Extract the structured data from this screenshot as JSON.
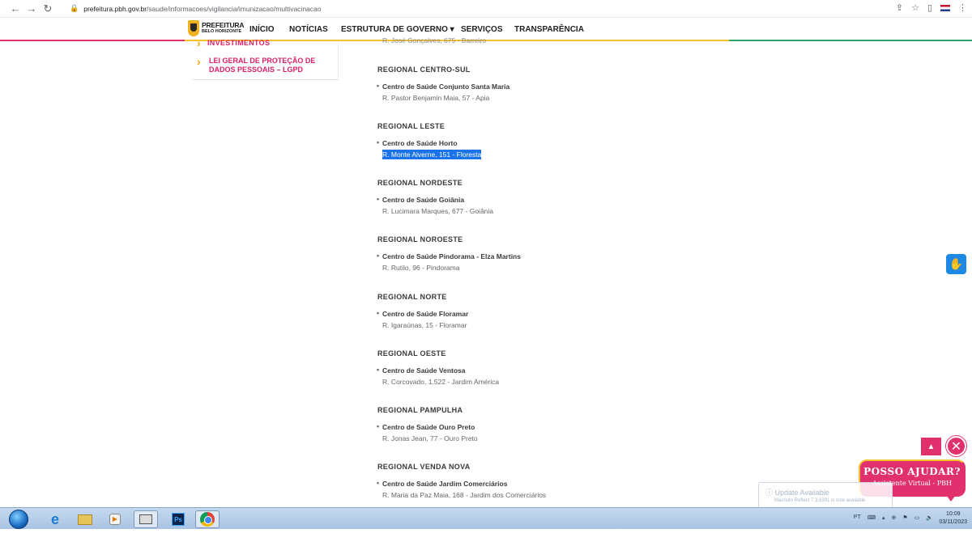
{
  "browser": {
    "url_domain": "prefeitura.pbh.gov.br",
    "url_path": "/saude/informacoes/vigilancia/imunizacao/multivacinacao"
  },
  "header": {
    "logo_line1": "PREFEITURA",
    "logo_line2": "BELO HORIZONTE",
    "menu": [
      {
        "label": "INÍCIO"
      },
      {
        "label": "NOTÍCIAS"
      },
      {
        "label": "ESTRUTURA DE GOVERNO ▾"
      },
      {
        "label": "SERVIÇOS"
      },
      {
        "label": "TRANSPARÊNCIA"
      }
    ]
  },
  "sidebar": {
    "cut_item": "INVESTIMENTOS",
    "item": "LEI GERAL DE PROTEÇÃO DE DADOS PESSOAIS – LGPD"
  },
  "main": {
    "cut_text": "R. José Gonçalves, 675 - Barreiro",
    "regions": [
      {
        "title": "REGIONAL CENTRO-SUL",
        "center": "Centro de Saúde Conjunto Santa Maria",
        "address": "R. Pastor Benjamin Maia, 57 - Apia"
      },
      {
        "title": "REGIONAL LESTE",
        "center": "Centro de Saúde Horto",
        "address": "R. Monte Alverne, 151 - Floresta"
      },
      {
        "title": "REGIONAL NORDESTE",
        "center": "Centro de Saúde Goiânia",
        "address": "R. Lucimara Marques, 677 - Goiânia"
      },
      {
        "title": "REGIONAL NOROESTE",
        "center": "Centro de Saúde Pindorama - Elza Martins",
        "address": "R. Rutilo, 96 - Pindorama"
      },
      {
        "title": "REGIONAL NORTE",
        "center": "Centro de Saúde Floramar",
        "address": "R. Igaraúnas, 15 - Floramar"
      },
      {
        "title": "REGIONAL OESTE",
        "center": "Centro de Saúde Ventosa",
        "address": "R. Corcovado, 1.522 - Jardim América"
      },
      {
        "title": "REGIONAL PAMPULHA",
        "center": "Centro de Saúde Ouro Preto",
        "address": "R. Jonas Jean, 77 - Ouro Preto"
      },
      {
        "title": "REGIONAL VENDA NOVA",
        "center": "Centro de Saúde Jardim Comerciários",
        "address": "R. Maria da Paz Maia, 168 - Jardim dos Comerciários"
      }
    ]
  },
  "assistant": {
    "title": "POSSO AJUDAR?",
    "subtitle": "Assistente Virtual - PBH"
  },
  "toast": {
    "title": "Update Available",
    "message": "Macrium Reflect 7.3.6391 is now available"
  },
  "taskbar": {
    "language": "PT",
    "time": "10:09",
    "date": "03/11/2023"
  },
  "colors": {
    "brand_pink": "#e0316e",
    "accent_yellow": "#f4c22e",
    "selection_blue": "#1a73e8"
  }
}
